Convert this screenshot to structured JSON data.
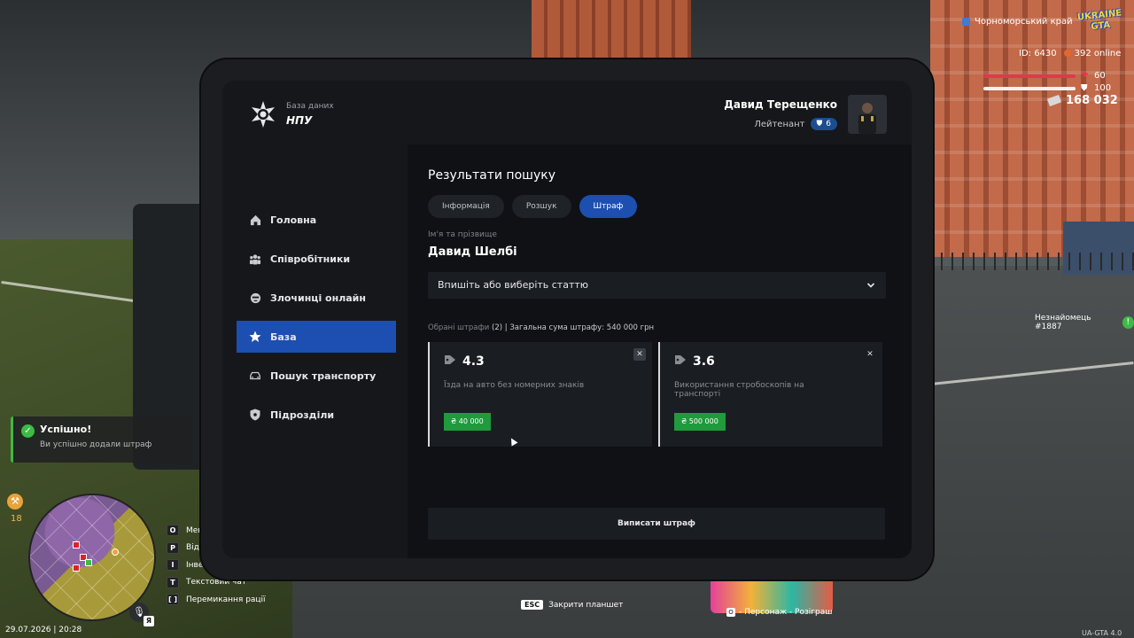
{
  "hud": {
    "region": "Чорноморський край",
    "logo": "UKRAINE GTA",
    "id_label": "ID: 6430",
    "online": "392 online",
    "health": "60",
    "armor": "100",
    "money": "168 032",
    "nearby_player": "Незнайомець #1887"
  },
  "toast": {
    "title": "Успішно!",
    "message": "Ви успішно додали штраф"
  },
  "minimap": {
    "hunger_value": "18",
    "mic_key": "Я",
    "keys": [
      {
        "key": "O",
        "label": "Меню"
      },
      {
        "key": "P",
        "label": "Відкрити"
      },
      {
        "key": "I",
        "label": "Інвентар"
      },
      {
        "key": "T",
        "label": "Текстовий чат"
      },
      {
        "key": "[ ]",
        "label": "Перемикання рації"
      }
    ],
    "datetime": "29.07.2026 | 20:28"
  },
  "bottom": {
    "esc_key": "ESC",
    "esc_label": "Закрити планшет",
    "promo_key": "O",
    "promo_label": "- Персонаж - Розіграш",
    "version": "UA-GTA 4.0"
  },
  "tablet": {
    "db_sub": "База даних",
    "db_name": "НПУ",
    "user_name": "Давид Терещенко",
    "user_rank": "Лейтенант",
    "rank_level": "6",
    "nav": [
      {
        "label": "Головна",
        "icon": "home-icon"
      },
      {
        "label": "Співробітники",
        "icon": "users-icon"
      },
      {
        "label": "Злочинці онлайн",
        "icon": "criminal-icon"
      },
      {
        "label": "База",
        "icon": "star-icon",
        "active": true
      },
      {
        "label": "Пошук транспорту",
        "icon": "car-icon"
      },
      {
        "label": "Підрозділи",
        "icon": "shield-icon"
      }
    ],
    "results_title": "Результати пошуку",
    "tabs": [
      {
        "label": "Інформація"
      },
      {
        "label": "Розшук"
      },
      {
        "label": "Штраф",
        "active": true
      }
    ],
    "fio_label": "Ім'я та прізвище",
    "fio_value": "Давид Шелбі",
    "article_placeholder": "Впишіть або виберіть статтю",
    "summary_label": "Обрані штрафи",
    "summary_count": "(2)",
    "summary_total": "| Загальна сума штрафу: 540 000 грн",
    "fines": [
      {
        "code": "4.3",
        "desc": "Їзда на авто без номерних знаків",
        "price": "₴ 40 000"
      },
      {
        "code": "3.6",
        "desc": "Використання стробоскопів на транспорті",
        "price": "₴ 500 000"
      }
    ],
    "issue_button": "Виписати штраф"
  },
  "colors": {
    "accent_blue": "#1c4fb0",
    "success_green": "#1f9a3c",
    "health_red": "#e0394a"
  }
}
